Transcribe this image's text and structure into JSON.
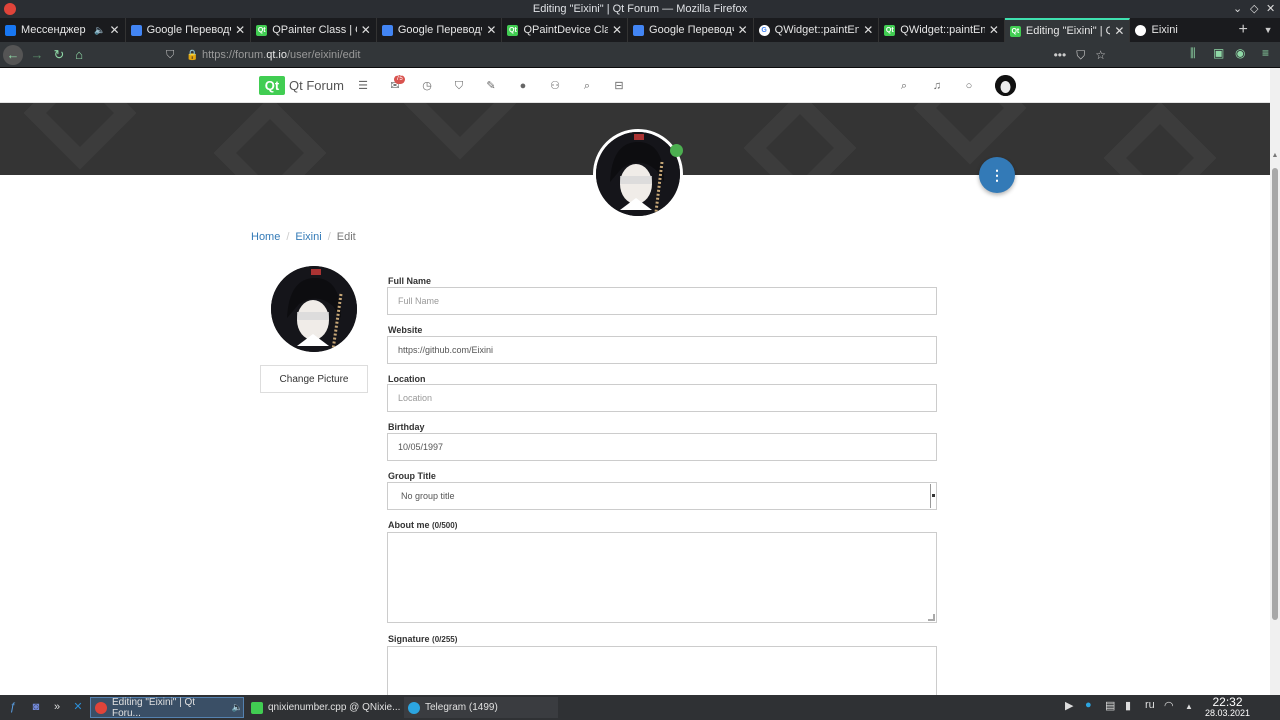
{
  "window": {
    "title": "Editing \"Eixini\" | Qt Forum — Mozilla Firefox"
  },
  "tabs": [
    {
      "label": "Мессенджер",
      "favicon_color": "#1877f2"
    },
    {
      "label": "Google Переводч",
      "favicon_color": "#4285f4"
    },
    {
      "label": "QPainter Class | Qt",
      "favicon_color": "#41cd52"
    },
    {
      "label": "Google Переводч",
      "favicon_color": "#4285f4"
    },
    {
      "label": "QPaintDevice Clas",
      "favicon_color": "#41cd52"
    },
    {
      "label": "Google Переводч",
      "favicon_color": "#4285f4"
    },
    {
      "label": "QWidget::paintEng",
      "favicon_color": "#ffffff"
    },
    {
      "label": "QWidget::paintEn",
      "favicon_color": "#41cd52"
    },
    {
      "label": "Editing \"Eixini\" | Qt",
      "favicon_color": "#41cd52"
    },
    {
      "label": "Eixini",
      "favicon_color": "#ffffff"
    }
  ],
  "urlbar": {
    "prefix": "https://forum.",
    "host": "qt.io",
    "path": "/user/eixini/edit"
  },
  "forum": {
    "logo_text": "Qt",
    "name": "Qt Forum",
    "notification_count": "75"
  },
  "breadcrumb": {
    "home": "Home",
    "user": "Eixini",
    "current": "Edit"
  },
  "profile": {
    "change_picture_label": "Change Picture"
  },
  "form": {
    "full_name": {
      "label": "Full Name",
      "placeholder": "Full Name",
      "value": ""
    },
    "website": {
      "label": "Website",
      "value": "https://github.com/Eixini"
    },
    "location": {
      "label": "Location",
      "placeholder": "Location",
      "value": ""
    },
    "birthday": {
      "label": "Birthday",
      "value": "10/05/1997"
    },
    "group_title": {
      "label": "Group Title",
      "value": "No group title"
    },
    "about_me": {
      "label": "About me",
      "counter": "(0/500)"
    },
    "signature": {
      "label": "Signature",
      "counter": "(0/255)"
    }
  },
  "taskbar": {
    "apps": [
      {
        "label": "Editing \"Eixini\" | Qt Foru...",
        "color": "#e0443a"
      },
      {
        "label": "qnixienumber.cpp @ QNixie...",
        "color": "#41cd52"
      },
      {
        "label": "Telegram (1499)",
        "color": "#2ca5e0"
      }
    ],
    "telegram_badge": "1499",
    "language": "ru",
    "time": "22:32",
    "date": "28.03.2021"
  },
  "colors": {
    "accent": "#337ab7",
    "qt_green": "#41cd52",
    "online": "#4caf50"
  }
}
